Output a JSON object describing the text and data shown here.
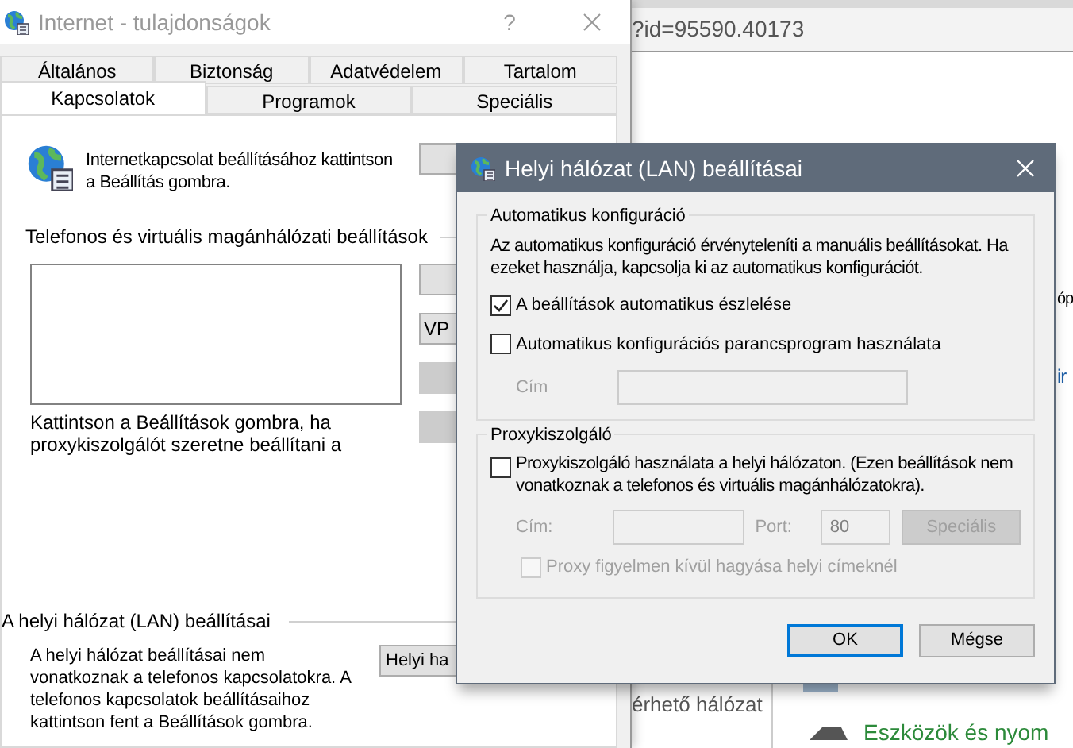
{
  "browser": {
    "address": "?id=95590.40173",
    "fragments": [
      {
        "text": "óp",
        "kind": "plain"
      },
      {
        "text": "ir",
        "kind": "link"
      }
    ],
    "sidebar_text": "érhető hálózat",
    "link": "Eszközök és nyom"
  },
  "properties": {
    "title": "Internet - tulajdonságok",
    "help": "?",
    "tab_rows": [
      {
        "tabs": [
          {
            "label": "Általános",
            "selected": false
          },
          {
            "label": "Biztonság",
            "selected": false
          },
          {
            "label": "Adatvédelem",
            "selected": false
          },
          {
            "label": "Tartalom",
            "selected": false
          }
        ]
      },
      {
        "tabs": [
          {
            "label": "Kapcsolatok",
            "selected": true
          },
          {
            "label": "Programok",
            "selected": false
          },
          {
            "label": "Speciális",
            "selected": false
          }
        ]
      }
    ],
    "connection_text": "Internetkapcsolat beállításához kattintson a Beállítás gombra.",
    "dialup": {
      "heading": "Telefonos és virtuális magánhálózati beállítások",
      "buttons": [
        {
          "disabled": false
        },
        {
          "label": "VP",
          "disabled": false
        },
        {
          "disabled": true
        },
        {
          "disabled": true
        }
      ]
    },
    "proxy_note": "Kattintson a Beállítások gombra, ha proxykiszolgálót szeretne beállítani a",
    "lan": {
      "heading": "A helyi hálózat (LAN) beállításai",
      "text": "A helyi hálózat beállításai nem vonatkoznak a telefonos kapcsolatokra. A telefonos kapcsolatok beállításaihoz kattintson fent a Beállítások gombra.",
      "button": "Helyi ha"
    }
  },
  "dialog": {
    "title": "Helyi hálózat (LAN) beállításai",
    "auto": {
      "heading": "Automatikus konfiguráció",
      "text": "Az automatikus konfiguráció érvényteleníti a manuális beállításokat. Ha ezeket használja, kapcsolja ki az automatikus konfigurációt.",
      "options": [
        {
          "label": "A beállítások automatikus észlelése",
          "checked": true
        },
        {
          "label": "Automatikus konfigurációs parancsprogram használata",
          "checked": false
        }
      ],
      "address_label": "Cím",
      "disabled": true
    },
    "proxy": {
      "heading": "Proxykiszolgáló",
      "option": {
        "label": "Proxykiszolgáló használata a helyi hálózaton. (Ezen beállítások nem vonatkoznak a telefonos és virtuális magánhálózatokra).",
        "checked": false
      },
      "address_label": "Cím:",
      "port_label": "Port:",
      "port": "80",
      "advanced": "Speciális",
      "disabled": true,
      "bypass": {
        "label": "Proxy figyelmen kívül hagyása helyi címeknél",
        "checked": false
      }
    },
    "buttons": [
      {
        "label": "OK",
        "default": true
      },
      {
        "label": "Mégse",
        "default": false
      }
    ]
  }
}
